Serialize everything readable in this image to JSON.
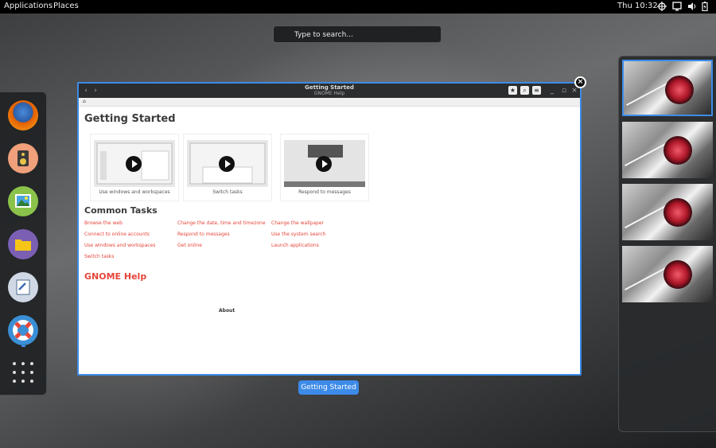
{
  "topbar": {
    "activities": "Applications",
    "places": "Places",
    "clock": "Thu 10:32",
    "icons": [
      "crosshair-icon",
      "display-icon",
      "volume-icon",
      "battery-icon"
    ]
  },
  "search": {
    "placeholder": "Type to search..."
  },
  "dash": {
    "apps": [
      {
        "name": "firefox-icon",
        "color": "#e66000"
      },
      {
        "name": "speaker-icon",
        "color": "#f08c4a"
      },
      {
        "name": "image-viewer-icon",
        "color": "#7ab32e"
      },
      {
        "name": "files-icon",
        "color": "#7b5fb3"
      },
      {
        "name": "notes-icon",
        "color": "#4d6c8f"
      },
      {
        "name": "help-lifebuoy-icon",
        "color": "#3a8fd6"
      }
    ],
    "show_apps_icon": "grid-icon"
  },
  "window": {
    "title": "Getting Started",
    "subtitle": "GNOME Help",
    "page_title": "Getting Started",
    "videos": [
      {
        "caption": "Use windows and workspaces"
      },
      {
        "caption": "Switch tasks"
      },
      {
        "caption": "Respond to messages"
      }
    ],
    "common_tasks_title": "Common Tasks",
    "tasks": [
      [
        "Browse the web",
        "Connect to online accounts",
        "Use windows and workspaces",
        "Switch tasks"
      ],
      [
        "Change the date, time and timezone",
        "Respond to messages",
        "Get online"
      ],
      [
        "Change the wallpaper",
        "Use the system search",
        "Launch applications"
      ]
    ],
    "gnome_help": "GNOME Help",
    "about": "About"
  },
  "window_label": "Getting Started",
  "colors": {
    "accent": "#3d8be8",
    "link": "#e5463b"
  },
  "workspaces": {
    "count": 4,
    "active": 1
  }
}
